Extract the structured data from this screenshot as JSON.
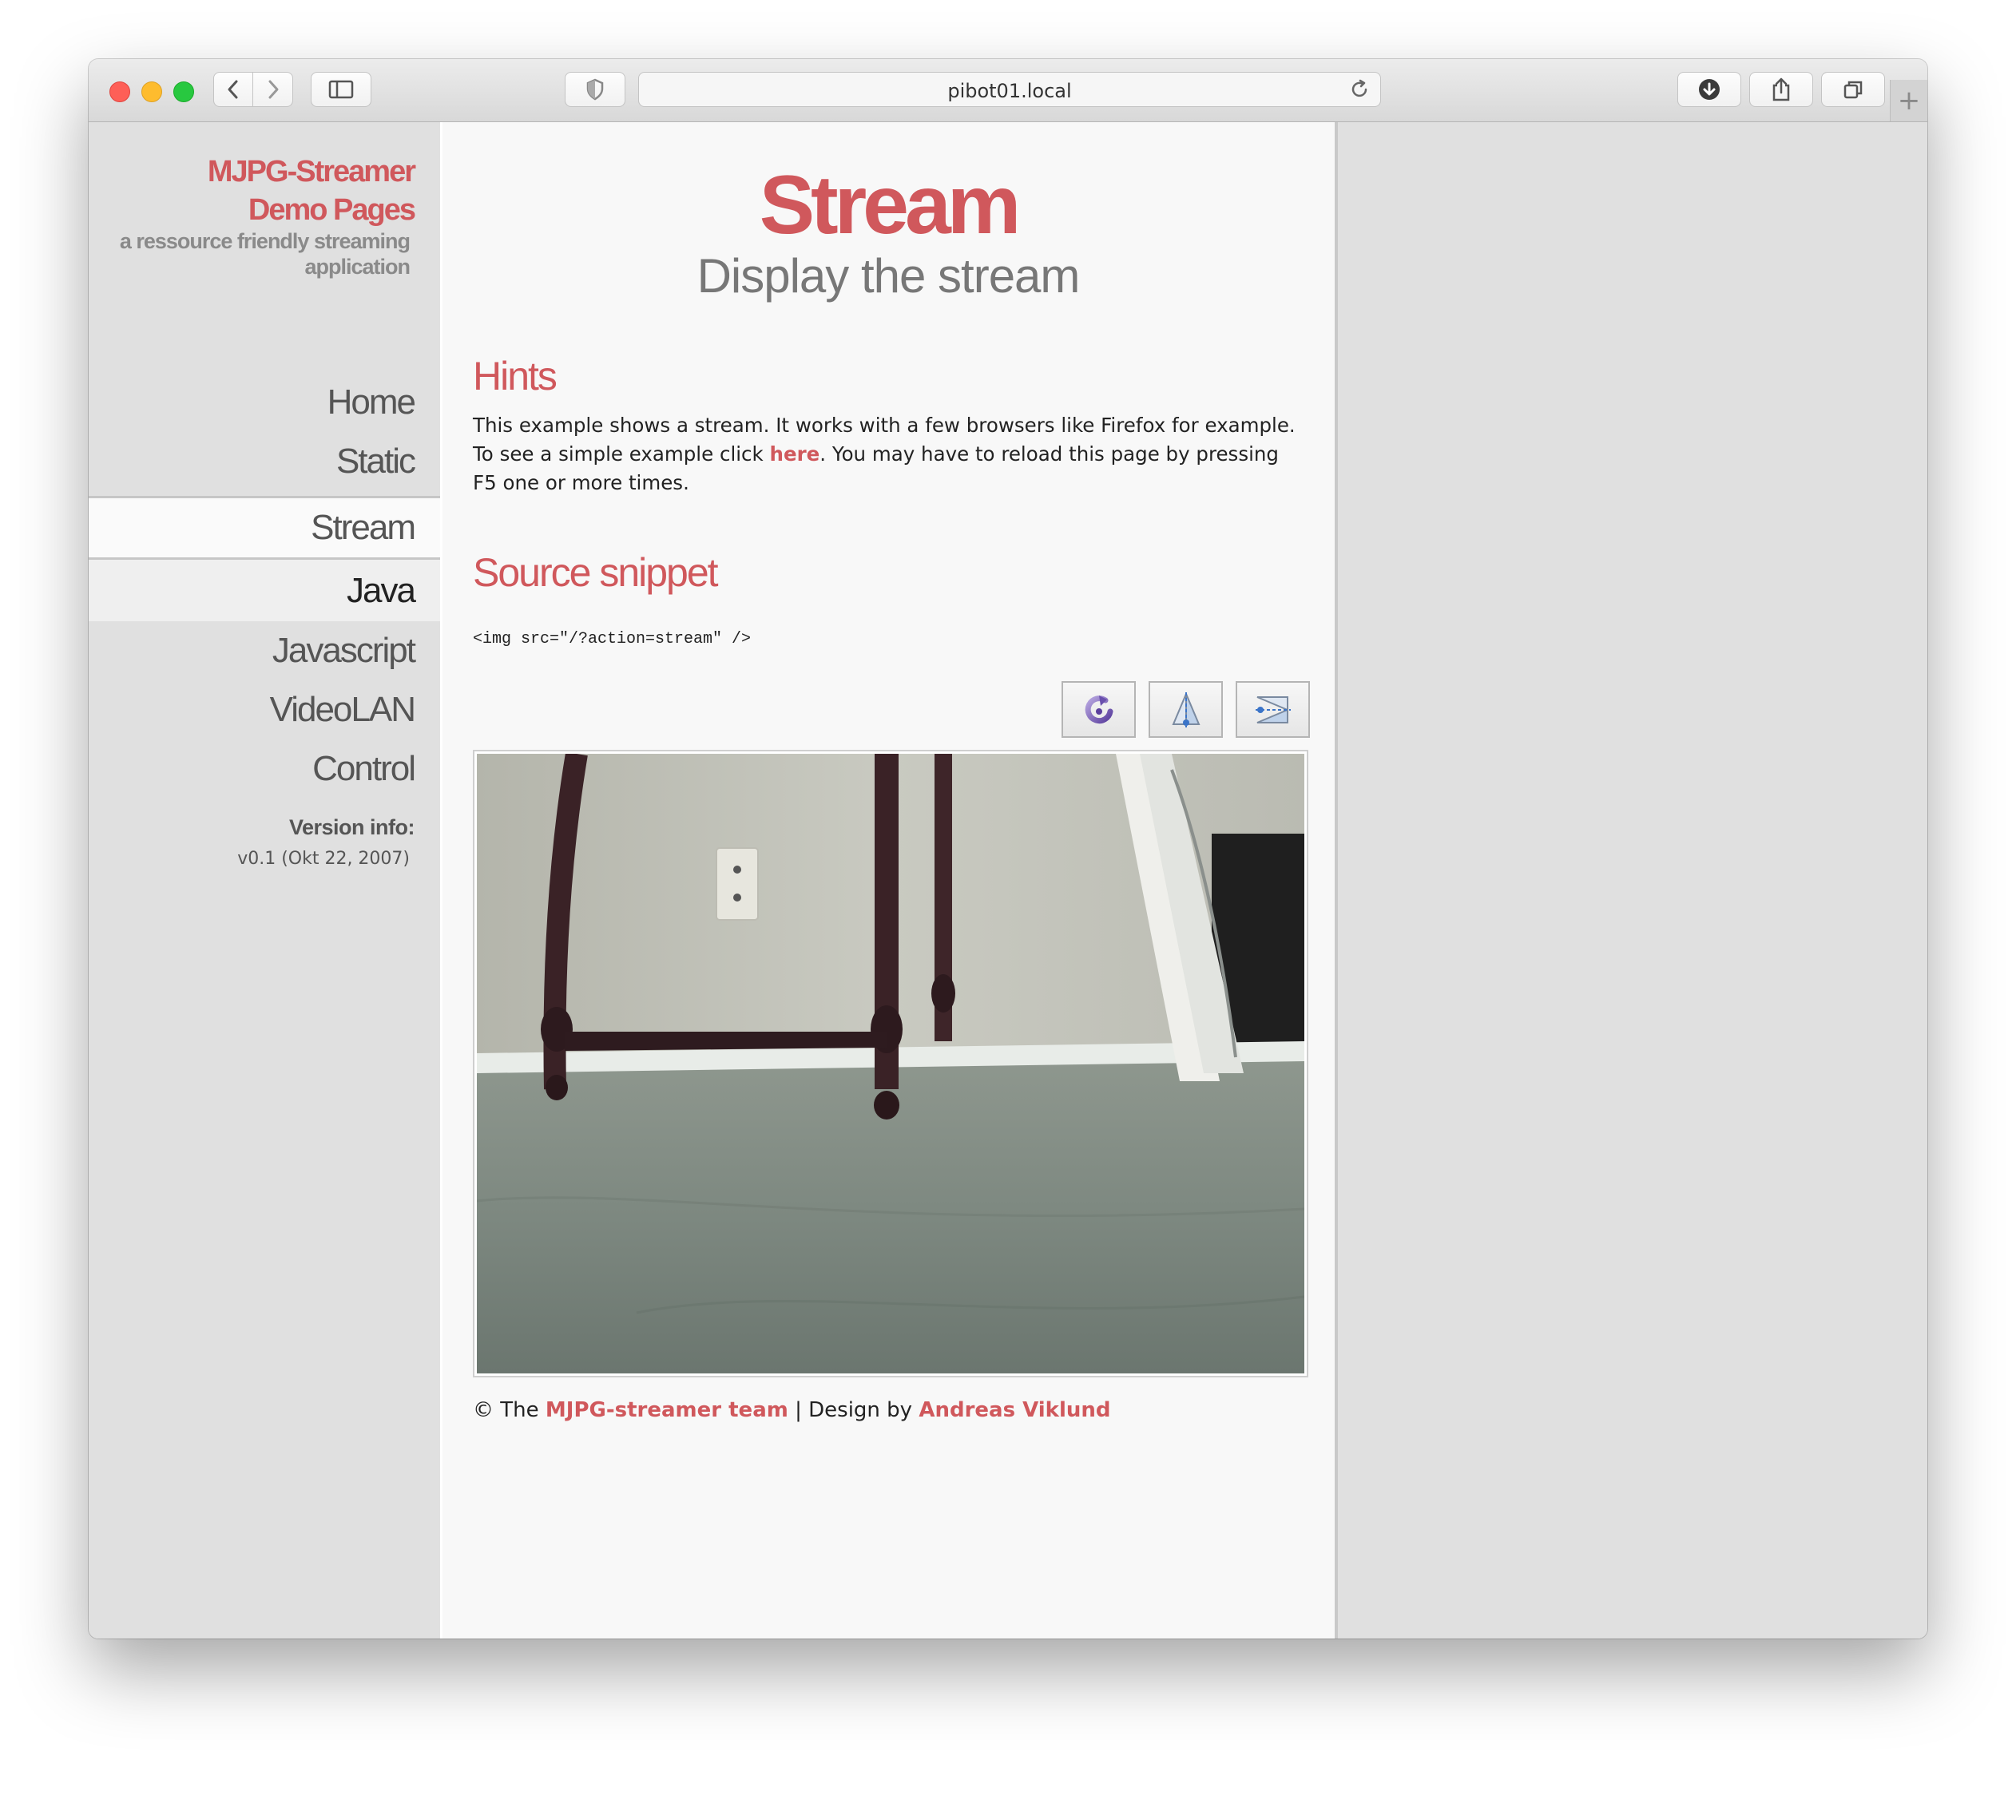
{
  "browser": {
    "url": "pibot01.local",
    "icons": {
      "back": "chevron-left-icon",
      "forward": "chevron-right-icon",
      "sidebar": "sidebar-icon",
      "privacy": "shield-icon",
      "reload": "reload-icon",
      "downloads": "download-icon",
      "share": "share-icon",
      "tabs": "tabs-icon",
      "new_tab": "+"
    }
  },
  "sidebar": {
    "brand_line1": "MJPG-Streamer",
    "brand_line2": "Demo Pages",
    "brand_sub": "a ressource friendly streaming application",
    "nav": [
      {
        "label": "Home"
      },
      {
        "label": "Static"
      },
      {
        "label": "Stream"
      },
      {
        "label": "Java"
      },
      {
        "label": "Javascript"
      },
      {
        "label": "VideoLAN"
      },
      {
        "label": "Control"
      }
    ],
    "version_label": "Version info:",
    "version_value": "v0.1 (Okt 22, 2007)"
  },
  "main": {
    "title": "Stream",
    "subtitle": "Display the stream",
    "hints_heading": "Hints",
    "hints_text_1": "This example shows a stream. It works with a few browsers like Firefox for example. To see a simple example click ",
    "hints_link": "here",
    "hints_text_2": ". You may have to reload this page by pressing F5 one or more times.",
    "source_heading": "Source snippet",
    "code": "<img src=\"/?action=stream\" />",
    "controls": [
      "rotate-icon",
      "flip-vertical-icon",
      "flip-horizontal-icon"
    ],
    "footer_prefix": "© The ",
    "footer_team": "MJPG-streamer team",
    "footer_mid": " | Design by ",
    "footer_designer": "Andreas Viklund"
  },
  "colors": {
    "accent": "#d0585c",
    "sidebar_bg": "#e0e0e0",
    "main_bg": "#f8f8f8"
  }
}
